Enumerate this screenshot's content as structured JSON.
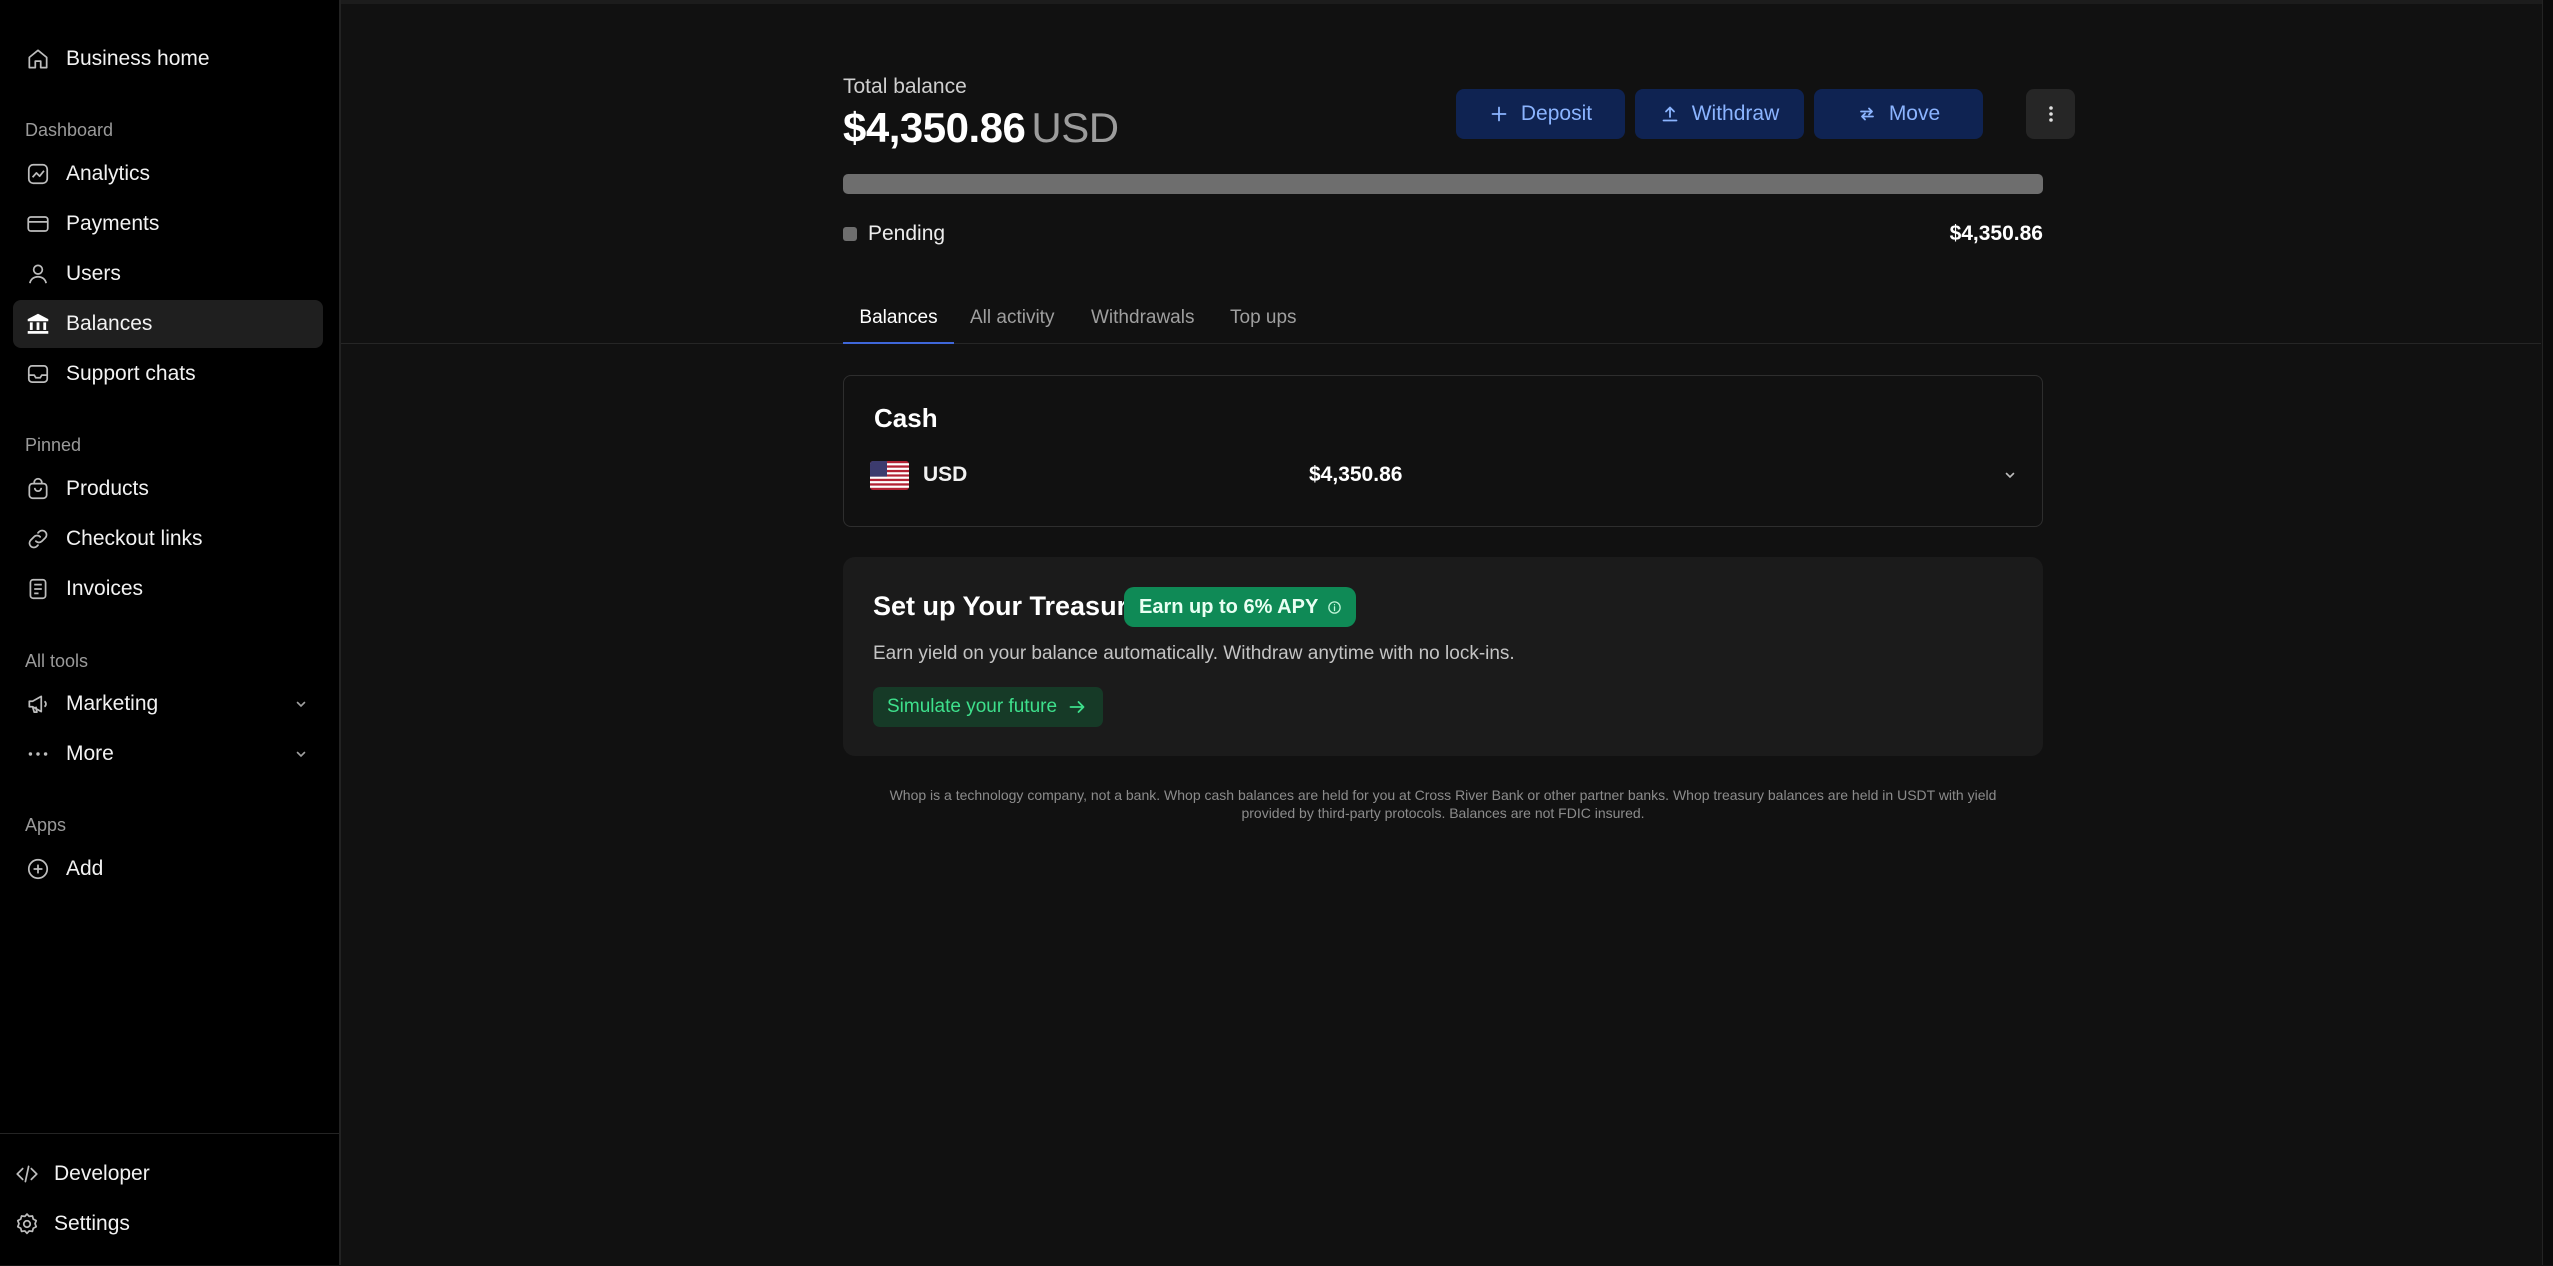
{
  "sidebar": {
    "business_home": "Business home",
    "section_dashboard": "Dashboard",
    "dashboard_items": [
      {
        "label": "Analytics",
        "icon": "analytics-icon"
      },
      {
        "label": "Payments",
        "icon": "card-icon"
      },
      {
        "label": "Users",
        "icon": "user-icon"
      },
      {
        "label": "Balances",
        "icon": "bank-icon",
        "active": true
      },
      {
        "label": "Support chats",
        "icon": "inbox-icon"
      }
    ],
    "section_pinned": "Pinned",
    "pinned_items": [
      {
        "label": "Products",
        "icon": "bag-icon"
      },
      {
        "label": "Checkout links",
        "icon": "link-icon"
      },
      {
        "label": "Invoices",
        "icon": "invoice-icon"
      }
    ],
    "section_tools": "All tools",
    "tools_items": [
      {
        "label": "Marketing",
        "icon": "megaphone-icon"
      },
      {
        "label": "More",
        "icon": "ellipsis-icon"
      }
    ],
    "section_apps": "Apps",
    "add_label": "Add",
    "developer_label": "Developer",
    "settings_label": "Settings"
  },
  "balance": {
    "total_label": "Total balance",
    "total_amount": "$4,350.86",
    "currency": "USD",
    "pending_label": "Pending",
    "pending_amount": "$4,350.86",
    "pending_fraction": 1.0
  },
  "actions": {
    "deposit": "Deposit",
    "withdraw": "Withdraw",
    "move": "Move"
  },
  "tabs": [
    {
      "label": "Balances",
      "active": true
    },
    {
      "label": "All activity"
    },
    {
      "label": "Withdrawals"
    },
    {
      "label": "Top ups"
    }
  ],
  "cash": {
    "title": "Cash",
    "rows": [
      {
        "currency": "USD",
        "amount": "$4,350.86"
      }
    ]
  },
  "treasury": {
    "title": "Set up Your Treasury",
    "badge": "Earn up to 6% APY",
    "description": "Earn yield on your balance automatically. Withdraw anytime with no lock-ins.",
    "button": "Simulate your future"
  },
  "disclaimer": {
    "line1": "Whop is a technology company, not a bank. Whop cash balances are held for you at Cross River Bank or other partner banks. Whop treasury balances are held in USDT with yield",
    "line2": "provided by third-party protocols. Balances are not FDIC insured."
  },
  "colors": {
    "background": "#111111",
    "sidebar": "#000000",
    "accent_button": "#0f2352",
    "accent_text": "#8bb4ff",
    "tab_underline": "#3f67d9",
    "treasury_badge": "#0f8a56",
    "treasury_button_text": "#3ee08c"
  }
}
